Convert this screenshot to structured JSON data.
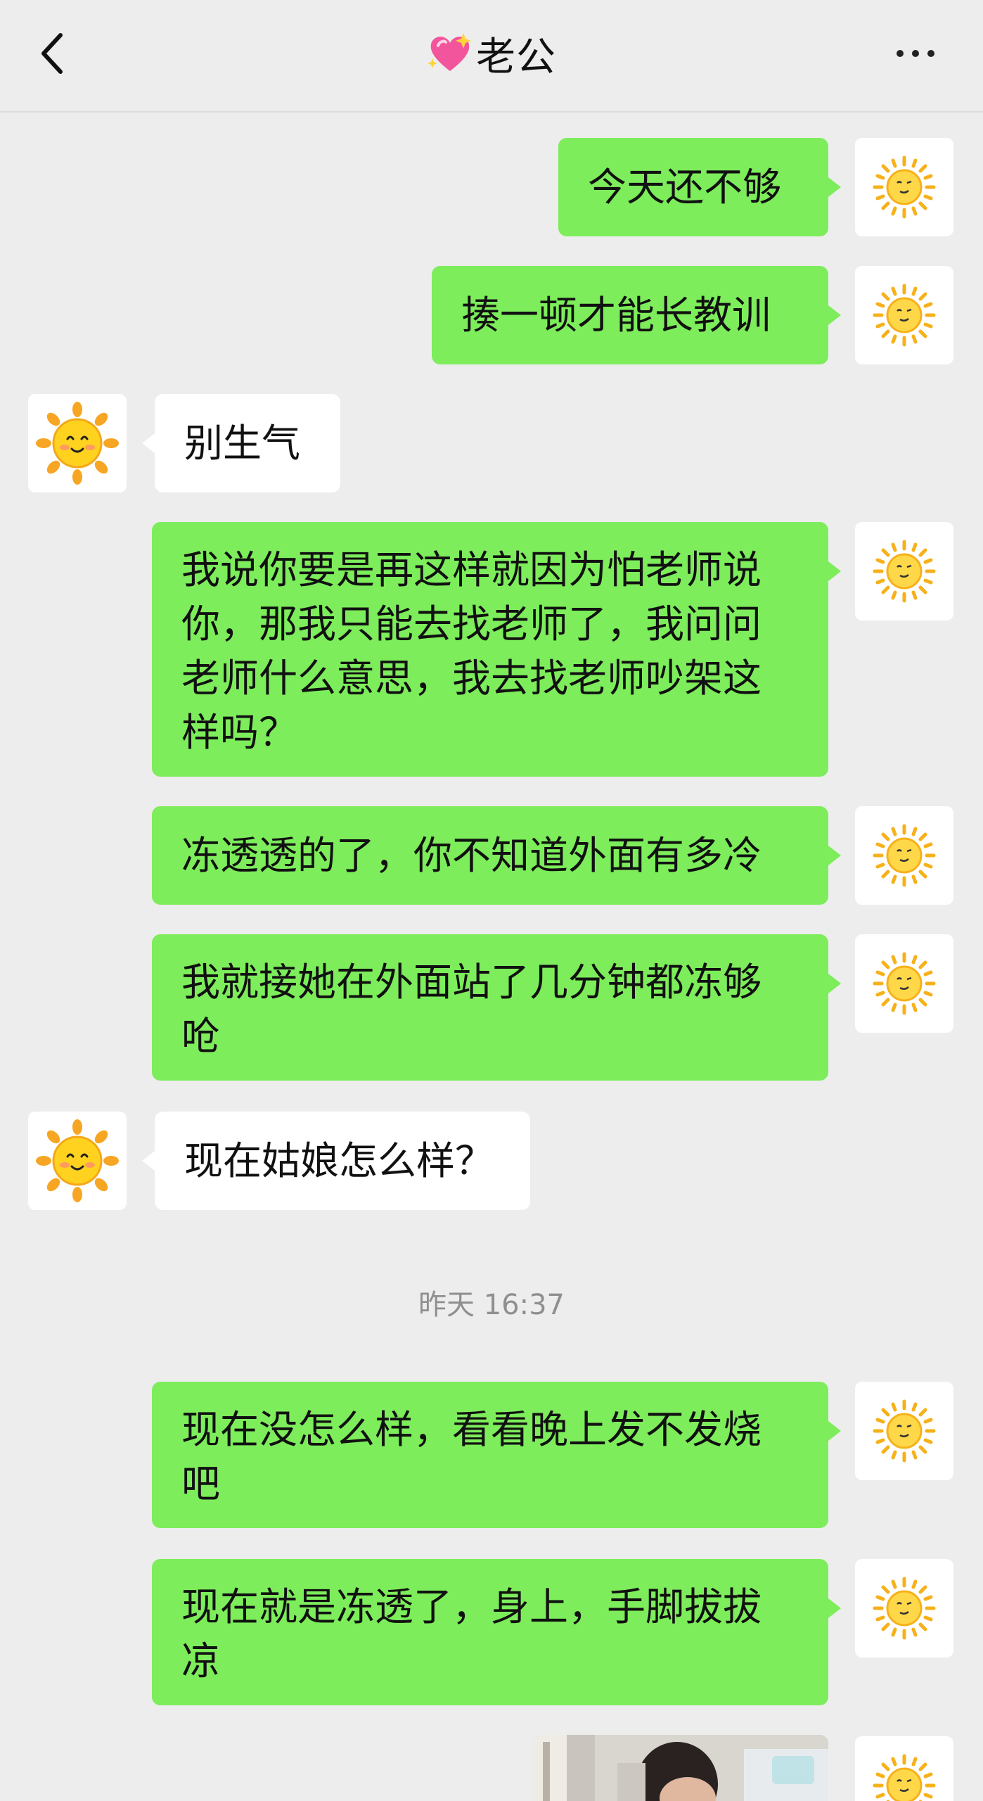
{
  "header": {
    "title": "老公",
    "title_emoji_icon": "sparkling-heart-icon",
    "back_icon": "chevron-left-icon",
    "more_icon": "more-dots-icon"
  },
  "colors": {
    "background": "#ededed",
    "sent_bubble": "#7ded5b",
    "received_bubble": "#ffffff",
    "timestamp_text": "#8f8f8f"
  },
  "messages": {
    "m1": {
      "sender": "me",
      "lines": [
        "今天还不够"
      ]
    },
    "m2": {
      "sender": "me",
      "lines": [
        "揍一顿才能长教训"
      ]
    },
    "m3": {
      "sender": "other",
      "lines": [
        "别生气"
      ]
    },
    "m4": {
      "sender": "me",
      "lines": [
        "我说你要是再这样就因为怕老师说",
        "你，那我只能去找老师了，我问问",
        "老师什么意思，我去找老师吵架这",
        "样吗？"
      ]
    },
    "m5": {
      "sender": "me",
      "lines": [
        "冻透透的了，你不知道外面有多冷"
      ]
    },
    "m6": {
      "sender": "me",
      "lines": [
        "我就接她在外面站了几分钟都冻够",
        "呛"
      ]
    },
    "m7": {
      "sender": "other",
      "lines": [
        "现在姑娘怎么样？"
      ]
    },
    "m8": {
      "sender": "me",
      "lines": [
        "现在没怎么样，看看晚上发不发烧",
        "吧"
      ]
    },
    "m9": {
      "sender": "me",
      "lines": [
        "现在就是冻透了，身上，手脚拔拔",
        "凉"
      ]
    },
    "m10": {
      "sender": "me",
      "type": "photo"
    }
  },
  "timestamp": "昨天 16:37",
  "avatars": {
    "me_icon": "sun-emoji-icon",
    "other_icon": "smiling-sun-icon"
  }
}
